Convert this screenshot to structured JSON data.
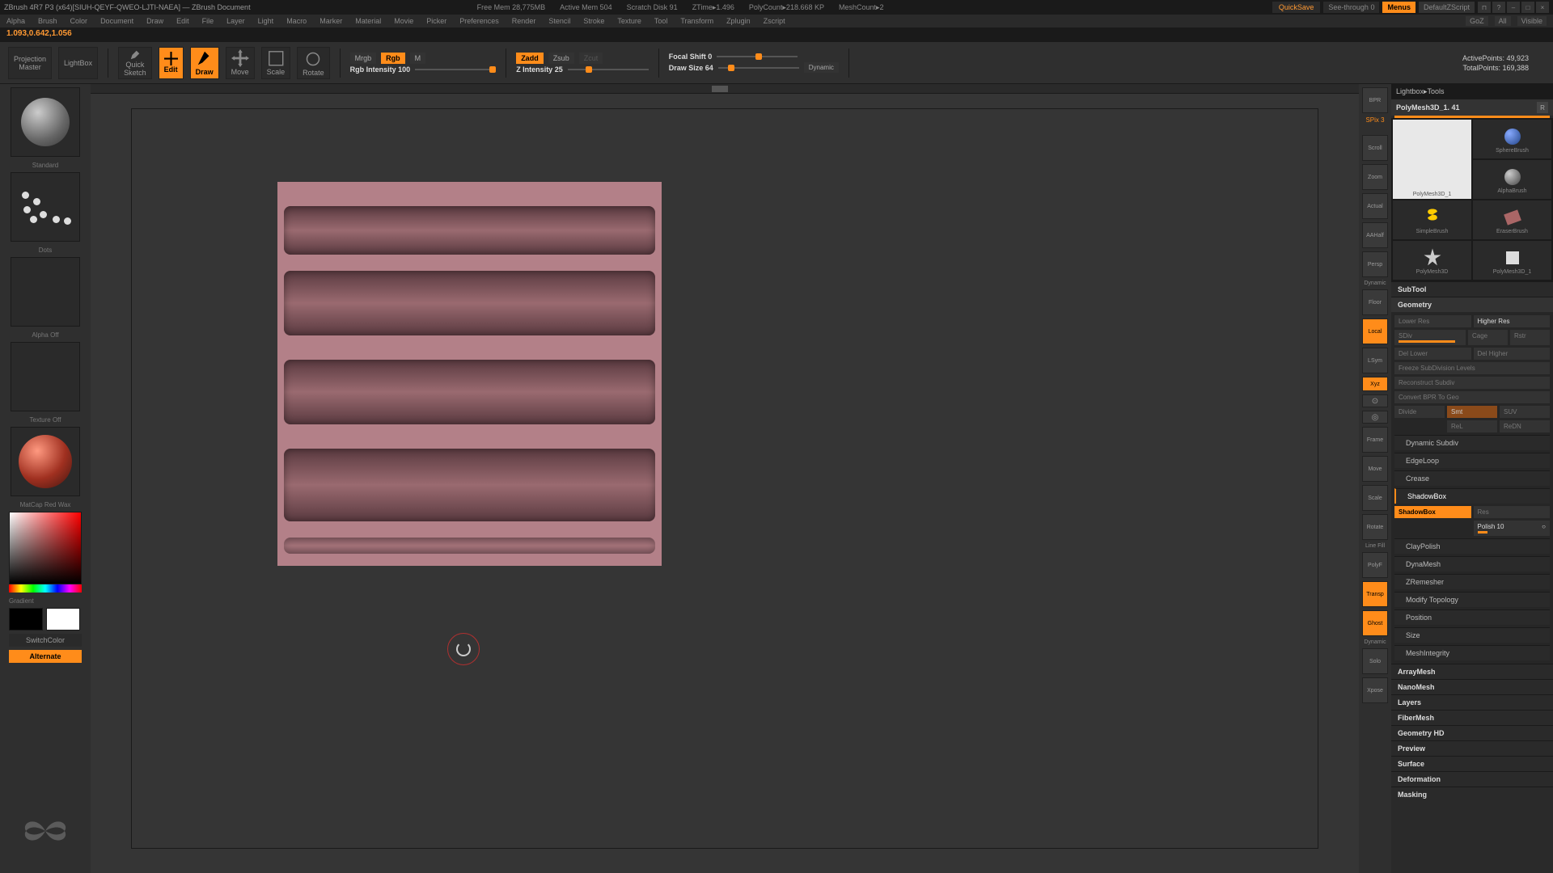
{
  "titlebar": {
    "app": "ZBrush 4R7 P3 (x64)[SIUH-QEYF-QWEO-LJTI-NAEA] — ZBrush Document",
    "stats": {
      "freemem": "Free Mem 28,775MB",
      "activemem": "Active Mem 504",
      "scratch": "Scratch Disk 91",
      "ztime": "ZTime▸1.496",
      "polycount": "PolyCount▸218.668 KP",
      "meshcount": "MeshCount▸2"
    },
    "quicksave": "QuickSave",
    "seethrough": "See-through  0",
    "menus": "Menus",
    "defscript": "DefaultZScript"
  },
  "menubar": {
    "items": [
      "Alpha",
      "Brush",
      "Color",
      "Document",
      "Draw",
      "Edit",
      "File",
      "Layer",
      "Light",
      "Macro",
      "Marker",
      "Material",
      "Movie",
      "Picker",
      "Preferences",
      "Render",
      "Stencil",
      "Stroke",
      "Texture",
      "Tool",
      "Transform",
      "Zplugin",
      "Zscript"
    ],
    "goz": "GoZ",
    "all": "All",
    "visible": "Visible"
  },
  "coords": "1.093,0.642,1.056",
  "toolbar": {
    "projection": "Projection\nMaster",
    "lightbox": "LightBox",
    "quicksketch": "Quick\nSketch",
    "edit": "Edit",
    "draw": "Draw",
    "move": "Move",
    "scale": "Scale",
    "rotate": "Rotate",
    "mrgb": "Mrgb",
    "rgb": "Rgb",
    "m": "M",
    "rgbint": "Rgb Intensity 100",
    "zadd": "Zadd",
    "zsub": "Zsub",
    "zcut": "Zcut",
    "zint": "Z Intensity 25",
    "focal": "Focal Shift 0",
    "drawsize": "Draw Size 64",
    "dynamic": "Dynamic",
    "active": "ActivePoints: 49,923",
    "total": "TotalPoints: 169,388"
  },
  "leftpanel": {
    "standard": "Standard",
    "dots": "Dots",
    "alpha": "Alpha Off",
    "texture": "Texture Off",
    "material": "MatCap Red Wax",
    "gradient": "Gradient",
    "switchcolor": "SwitchColor",
    "alternate": "Alternate"
  },
  "vtoolbar": {
    "bpr": "BPR",
    "spix": "SPix 3",
    "scroll": "Scroll",
    "zoom": "Zoom",
    "actual": "Actual",
    "aahalf": "AAHalf",
    "persp": "Persp",
    "floor": "Floor",
    "local": "Local",
    "lsym": "LSym",
    "xyz": "Xyz",
    "frame": "Frame",
    "move": "Move",
    "scale": "Scale",
    "rotate": "Rotate",
    "polyf": "PolyF",
    "transp": "Transp",
    "ghost": "Ghost",
    "solo": "Solo",
    "xpose": "Xpose",
    "dynamic": "Dynamic"
  },
  "rightpanel": {
    "header": "Lightbox▸Tools",
    "toolname": "PolyMesh3D_1. 41",
    "thumbs": [
      {
        "name": "PolyMesh3D_1"
      },
      {
        "name": "SphereBrush"
      },
      {
        "name": "AlphaBrush"
      },
      {
        "name": "SimpleBrush"
      },
      {
        "name": "EraserBrush"
      },
      {
        "name": "PolyMesh3D"
      },
      {
        "name": "PolyMesh3D_1"
      }
    ],
    "subtool": "SubTool",
    "geometry": "Geometry",
    "geo": {
      "lowerres": "Lower Res",
      "higherres": "Higher Res",
      "sdiv": "SDiv",
      "cage": "Cage",
      "rstr": "Rstr",
      "dellower": "Del Lower",
      "delhigher": "Del Higher",
      "freeze": "Freeze SubDivision Levels",
      "reconstruct": "Reconstruct Subdiv",
      "convert": "Convert BPR To Geo",
      "divide": "Divide",
      "smt": "Smt",
      "suv": "SUV",
      "rel": "ReL",
      "redn": "ReDN"
    },
    "dynsubdiv": "Dynamic Subdiv",
    "edgeloop": "EdgeLoop",
    "crease": "Crease",
    "shadowbox_h": "ShadowBox",
    "shadowbox": "ShadowBox",
    "res": "Res",
    "polish": "Polish 10",
    "claypolish": "ClayPolish",
    "dynamesh": "DynaMesh",
    "zremesher": "ZRemesher",
    "modtopo": "Modify Topology",
    "position": "Position",
    "size": "Size",
    "meshint": "MeshIntegrity",
    "others": [
      "ArrayMesh",
      "NanoMesh",
      "Layers",
      "FiberMesh",
      "Geometry HD",
      "Preview",
      "Surface",
      "Deformation",
      "Masking"
    ]
  }
}
